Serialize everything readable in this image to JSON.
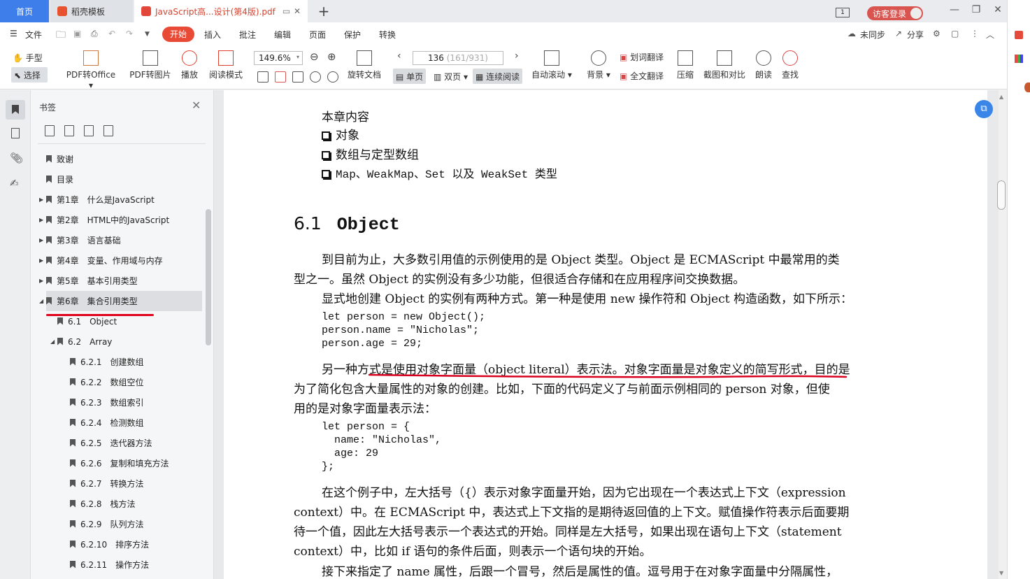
{
  "tabs": {
    "home": "首页",
    "templates": "稻壳模板",
    "pdf": "JavaScript高...设计(第4版).pdf"
  },
  "titlebar": {
    "login": "访客登录",
    "page_indicator": "1"
  },
  "menu": {
    "file": "文件",
    "start": "开始",
    "insert": "插入",
    "annotate": "批注",
    "edit": "编辑",
    "page": "页面",
    "protect": "保护",
    "convert": "转换",
    "unsync": "未同步",
    "share": "分享"
  },
  "toolbar": {
    "hand": "手型",
    "select": "选择",
    "pdf2office": "PDF转Office",
    "pdf2img": "PDF转图片",
    "play": "播放",
    "readmode": "阅读模式",
    "zoom": "149.6%",
    "page_current": "136",
    "page_total": "(161/931)",
    "rotate": "旋转文档",
    "single": "单页",
    "double": "双页",
    "continuous": "连续阅读",
    "autoscroll": "自动滚动",
    "background": "背景",
    "wordtrans": "划词翻译",
    "fulltrans": "全文翻译",
    "compress": "压缩",
    "screenshot": "截图和对比",
    "read": "朗读",
    "find": "查找"
  },
  "bookmarks": {
    "title": "书签",
    "items": [
      {
        "label": "致谢"
      },
      {
        "label": "目录"
      },
      {
        "label": "第1章　什么是JavaScript"
      },
      {
        "label": "第2章　HTML中的JavaScript"
      },
      {
        "label": "第3章　语言基础"
      },
      {
        "label": "第4章　变量、作用域与内存"
      },
      {
        "label": "第5章　基本引用类型"
      },
      {
        "label": "第6章　集合引用类型"
      },
      {
        "label": "6.1　Object"
      },
      {
        "label": "6.2　Array"
      },
      {
        "label": "6.2.1　创建数组"
      },
      {
        "label": "6.2.2　数组空位"
      },
      {
        "label": "6.2.3　数组索引"
      },
      {
        "label": "6.2.4　检测数组"
      },
      {
        "label": "6.2.5　迭代器方法"
      },
      {
        "label": "6.2.6　复制和填充方法"
      },
      {
        "label": "6.2.7　转换方法"
      },
      {
        "label": "6.2.8　栈方法"
      },
      {
        "label": "6.2.9　队列方法"
      },
      {
        "label": "6.2.10　排序方法"
      },
      {
        "label": "6.2.11　操作方法"
      }
    ]
  },
  "doc": {
    "contents_title": "本章内容",
    "contents": [
      "对象",
      "数组与定型数组",
      "Map、WeakMap、Set 以及 WeakSet 类型"
    ],
    "h_num": "6.1",
    "h_text": "Object",
    "p1a": "到目前为止，大多数引用值的示例使用的是 Object 类型。Object 是 ECMAScript 中最常用的类",
    "p1b": "型之一。虽然 Object 的实例没有多少功能，但很适合存储和在应用程序间交换数据。",
    "p2": "显式地创建 Object 的实例有两种方式。第一种是使用 new 操作符和 Object 构造函数，如下所示：",
    "code1": [
      "let person = new Object();",
      "person.name = \"Nicholas\";",
      "person.age = 29;"
    ],
    "p3a": "另一种方式是使用对象字面量（object literal）表示法。对象字面量是对象定义的简写形式，目的是",
    "p3b": "为了简化包含大量属性的对象的创建。比如，下面的代码定义了与前面示例相同的 person 对象，但使",
    "p3c": "用的是对象字面量表示法：",
    "code2": [
      "let person = {",
      "  name: \"Nicholas\",",
      "  age: 29",
      "};"
    ],
    "p4a": "在这个例子中，左大括号（{）表示对象字面量开始，因为它出现在一个表达式上下文（expression",
    "p4b": "context）中。在 ECMAScript 中，表达式上下文指的是期待返回值的上下文。赋值操作符表示后面要期",
    "p4c": "待一个值，因此左大括号表示一个表达式的开始。同样是左大括号，如果出现在语句上下文（statement",
    "p4d": "context）中，比如 if 语句的条件后面，则表示一个语句块的开始。",
    "p5": "接下来指定了 name 属性，后跟一个冒号，然后是属性的值。逗号用于在对象字面量中分隔属性，"
  }
}
